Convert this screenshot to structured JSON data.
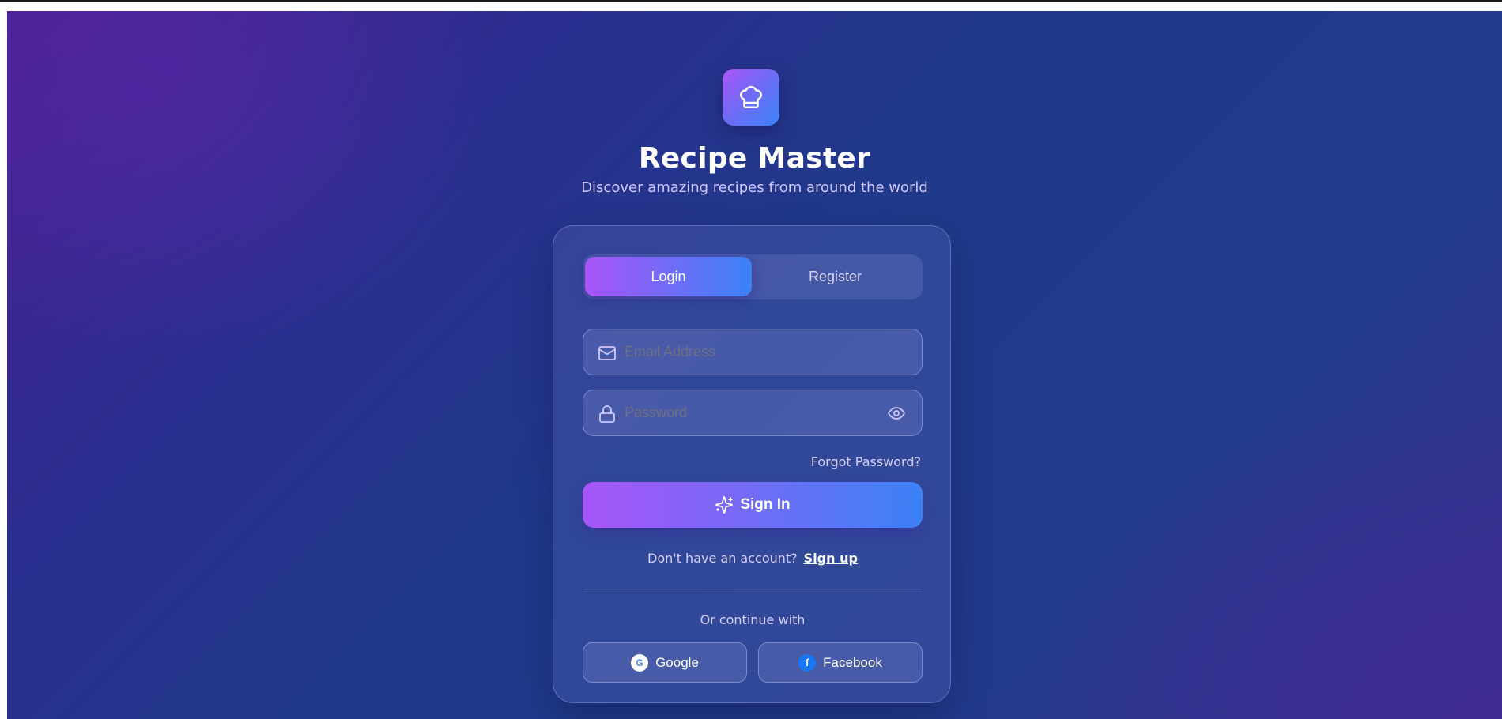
{
  "app": {
    "title": "Recipe Master",
    "subtitle": "Discover amazing recipes from around the world",
    "logo_icon": "chef-hat-icon"
  },
  "tabs": [
    {
      "label": "Login",
      "active": true
    },
    {
      "label": "Register",
      "active": false
    }
  ],
  "form": {
    "email": {
      "value": "",
      "placeholder": "Email Address",
      "icon": "mail-icon"
    },
    "password": {
      "value": "",
      "placeholder": "Password",
      "icon": "lock-icon",
      "toggle_icon": "eye-icon"
    },
    "forgot_label": "Forgot Password?",
    "submit_label": "Sign In",
    "submit_icon": "sparkles-icon",
    "no_account_text": "Don't have an account?",
    "signup_label": "Sign up"
  },
  "social": {
    "divider_text": "Or continue with",
    "buttons": [
      {
        "label": "Google",
        "badge": "G",
        "icon": "google-icon"
      },
      {
        "label": "Facebook",
        "badge": "f",
        "icon": "facebook-icon"
      }
    ]
  },
  "colors": {
    "accent_start": "#a855f7",
    "accent_end": "#3b82f6",
    "background_top_left": "#4a1f92",
    "background_center": "#1f3a8a"
  }
}
